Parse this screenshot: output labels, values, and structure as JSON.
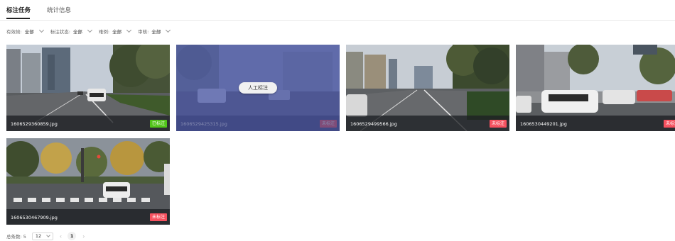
{
  "tabs": [
    {
      "label": "标注任务",
      "active": true
    },
    {
      "label": "统计信息",
      "active": false
    }
  ],
  "filters": [
    {
      "label": "有效帧:",
      "value": "全部"
    },
    {
      "label": "标注状态:",
      "value": "全部"
    },
    {
      "label": "难例:",
      "value": "全部"
    },
    {
      "label": "审核:",
      "value": "全部"
    }
  ],
  "cards": [
    {
      "filename": "1606529360859.jpg",
      "status": "已标注",
      "status_color": "#52c41a"
    },
    {
      "filename": "1606529425315.jpg",
      "status": "未标注",
      "status_color": "#f5515f",
      "hover_button": "人工标注"
    },
    {
      "filename": "1606529499566.jpg",
      "status": "未标注",
      "status_color": "#f5515f"
    },
    {
      "filename": "1606530449201.jpg",
      "status": "未标注",
      "status_color": "#f5515f"
    },
    {
      "filename": "1606530467909.jpg",
      "status": "未标注",
      "status_color": "#f5515f"
    }
  ],
  "pagination": {
    "total_label": "总条数: 5",
    "page_size": "12",
    "prev_icon": "chevron-left-icon",
    "next_icon": "chevron-right-icon",
    "current_page": "1"
  }
}
